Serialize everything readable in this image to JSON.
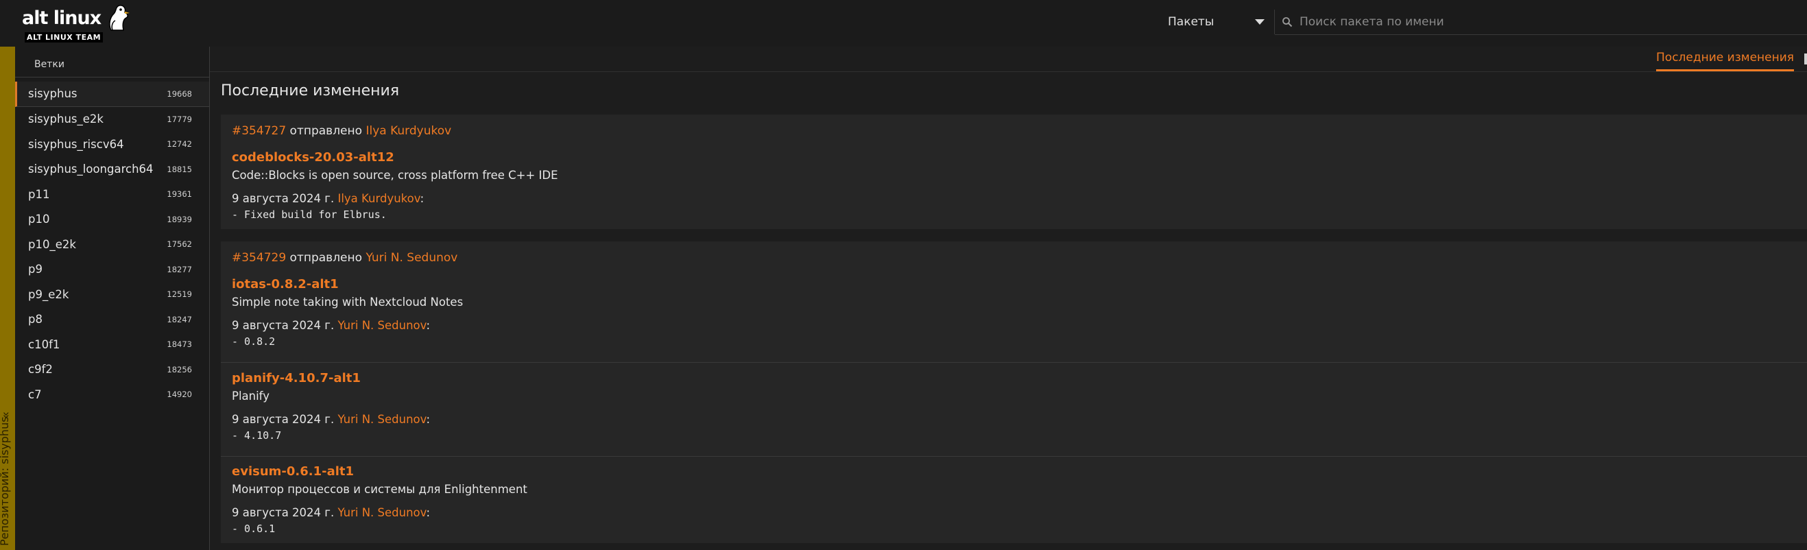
{
  "header": {
    "logo_main": "alt linux",
    "logo_sub": "ALT LINUX TEAM",
    "search_type": "Пакеты",
    "search_placeholder": "Поиск пакета по имени"
  },
  "repo_bar": {
    "label": "Репозиторий: sisyphus",
    "chevron": "«"
  },
  "sidebar": {
    "title": "Ветки",
    "branches": [
      {
        "name": "sisyphus",
        "count": "19668"
      },
      {
        "name": "sisyphus_e2k",
        "count": "17779"
      },
      {
        "name": "sisyphus_riscv64",
        "count": "12742"
      },
      {
        "name": "sisyphus_loongarch64",
        "count": "18815"
      },
      {
        "name": "p11",
        "count": "19361"
      },
      {
        "name": "p10",
        "count": "18939"
      },
      {
        "name": "p10_e2k",
        "count": "17562"
      },
      {
        "name": "p9",
        "count": "18277"
      },
      {
        "name": "p9_e2k",
        "count": "12519"
      },
      {
        "name": "p8",
        "count": "18247"
      },
      {
        "name": "c10f1",
        "count": "18473"
      },
      {
        "name": "c9f2",
        "count": "18256"
      },
      {
        "name": "c7",
        "count": "14920"
      }
    ]
  },
  "tabs": {
    "latest": "Последние изменения"
  },
  "main": {
    "title": "Последние изменения",
    "sent_word": "отправлено",
    "tasks": [
      {
        "id": "#354727",
        "author": "Ilya Kurdyukov",
        "packages": [
          {
            "name": "codeblocks-20.03-alt12",
            "desc": "Code::Blocks is open source, cross platform free C++ IDE",
            "date": "9 августа 2024 г.",
            "author": "Ilya Kurdyukov",
            "log": "- Fixed build for Elbrus."
          }
        ]
      },
      {
        "id": "#354729",
        "author": "Yuri N. Sedunov",
        "packages": [
          {
            "name": "iotas-0.8.2-alt1",
            "desc": "Simple note taking with Nextcloud Notes",
            "date": "9 августа 2024 г.",
            "author": "Yuri N. Sedunov",
            "log": "- 0.8.2"
          },
          {
            "name": "planify-4.10.7-alt1",
            "desc": "Planify",
            "date": "9 августа 2024 г.",
            "author": "Yuri N. Sedunov",
            "log": "- 4.10.7"
          },
          {
            "name": "evisum-0.6.1-alt1",
            "desc": "Монитор процессов и системы для Enlightenment",
            "date": "9 августа 2024 г.",
            "author": "Yuri N. Sedunov",
            "log": "- 0.6.1"
          }
        ]
      }
    ]
  },
  "colors": {
    "accent": "#f07b24",
    "repo_bar": "#8a7000",
    "background": "#1d1d1d",
    "card": "#262626"
  }
}
